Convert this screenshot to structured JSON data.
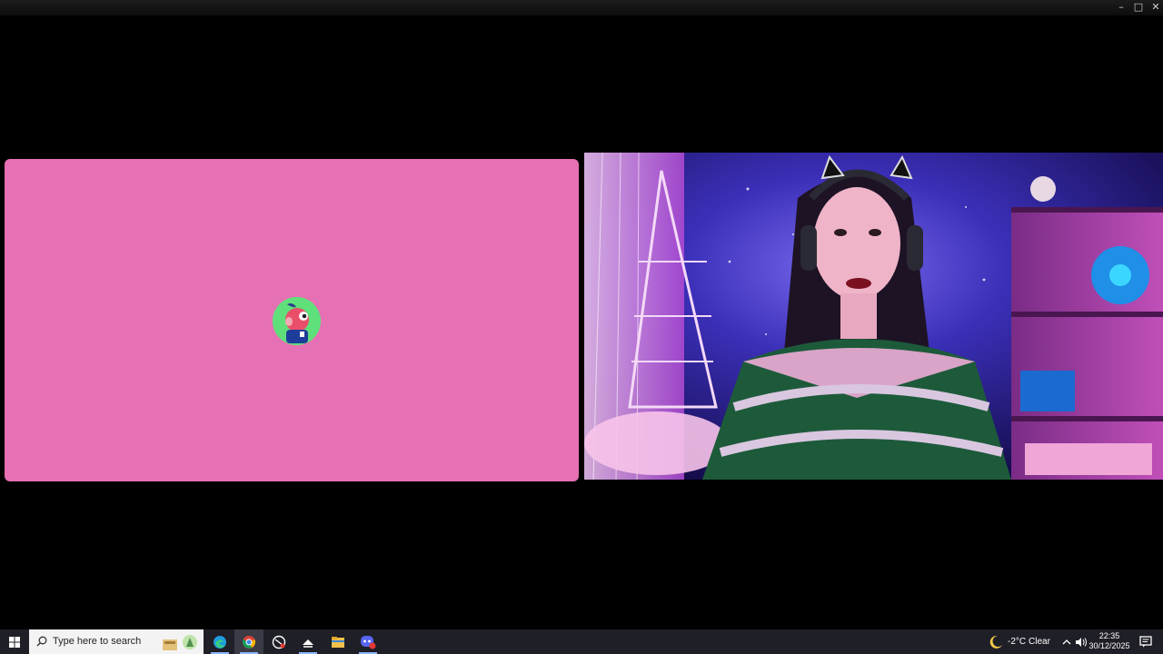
{
  "window": {
    "controls": {
      "minimize": "–",
      "maximize": "□",
      "close": "✕"
    }
  },
  "call": {
    "left_tile": {
      "background": "#e670b4",
      "avatar_bg": "#5fe07a"
    }
  },
  "taskbar": {
    "search_placeholder": "Type here to search",
    "apps": [
      "start-icon",
      "edge-icon",
      "chrome-icon",
      "app-icon",
      "steam-icon",
      "file-explorer-icon",
      "discord-icon"
    ],
    "weather": {
      "temperature": "-2°C",
      "condition": "Clear",
      "icon": "moon-icon"
    },
    "clock": {
      "time": "22:35",
      "date": "30/12/2025"
    }
  }
}
